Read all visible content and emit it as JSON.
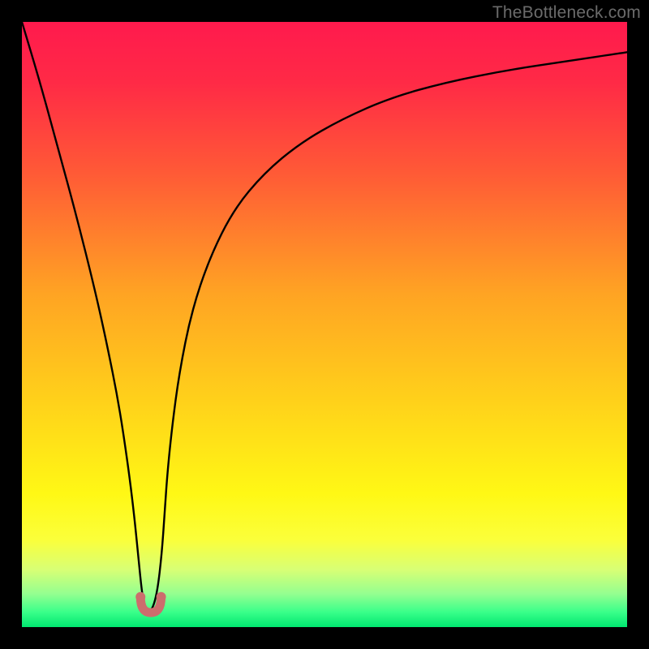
{
  "watermark": {
    "text": "TheBottleneck.com"
  },
  "plot": {
    "frame_color": "#000000",
    "gradient_stops": [
      {
        "offset": 0.0,
        "color": "#ff1a4d"
      },
      {
        "offset": 0.1,
        "color": "#ff2a46"
      },
      {
        "offset": 0.25,
        "color": "#ff5a36"
      },
      {
        "offset": 0.45,
        "color": "#ffa423"
      },
      {
        "offset": 0.63,
        "color": "#ffd21a"
      },
      {
        "offset": 0.78,
        "color": "#fff815"
      },
      {
        "offset": 0.855,
        "color": "#fbff3a"
      },
      {
        "offset": 0.905,
        "color": "#d8ff75"
      },
      {
        "offset": 0.945,
        "color": "#94ff90"
      },
      {
        "offset": 0.975,
        "color": "#3aff8a"
      },
      {
        "offset": 1.0,
        "color": "#00e770"
      }
    ]
  },
  "chart_data": {
    "type": "line",
    "title": "",
    "xlabel": "",
    "ylabel": "",
    "xlim": [
      0,
      100
    ],
    "ylim": [
      0,
      100
    ],
    "series": [
      {
        "name": "bottleneck-curve",
        "x": [
          0,
          3,
          6,
          9,
          12,
          14,
          16,
          17.5,
          18.5,
          19.3,
          19.8,
          20.3,
          20.8,
          21.6,
          22.4,
          23.1,
          23.6,
          24.0,
          24.8,
          26,
          28,
          31,
          35,
          40,
          46,
          53,
          61,
          70,
          80,
          90,
          100
        ],
        "y": [
          100,
          90,
          79,
          68,
          56,
          47,
          37,
          27,
          19,
          11,
          6,
          3,
          2.5,
          3,
          6,
          12,
          19,
          25,
          33,
          42,
          52,
          61,
          69,
          75,
          80,
          84,
          87.5,
          90,
          92,
          93.5,
          95
        ]
      }
    ],
    "markers": [
      {
        "name": "valley-left-dot",
        "x": 19.6,
        "y": 5.0,
        "color": "#cc6d6d"
      },
      {
        "name": "valley-right-dot",
        "x": 23.0,
        "y": 5.0,
        "color": "#cc6d6d"
      }
    ],
    "valley_arc": {
      "color": "#cc6d6d",
      "thickness": 11,
      "start_x": 19.6,
      "end_x": 23.0,
      "depth_y": 2.4,
      "top_y": 5.0
    }
  }
}
